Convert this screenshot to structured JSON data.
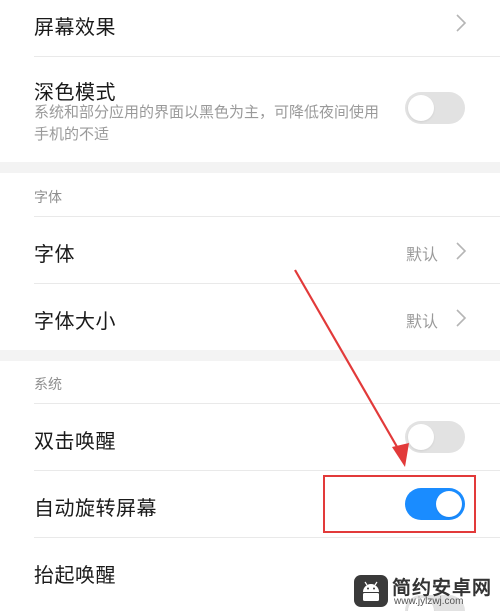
{
  "settings": {
    "screen_effect": {
      "title": "屏幕效果"
    },
    "dark_mode": {
      "title": "深色模式",
      "description": "系统和部分应用的界面以黑色为主，可降低夜间使用手机的不适",
      "enabled": false
    },
    "font_section": {
      "header": "字体",
      "font": {
        "title": "字体",
        "value": "默认"
      },
      "font_size": {
        "title": "字体大小",
        "value": "默认"
      }
    },
    "system_section": {
      "header": "系统",
      "double_tap_wake": {
        "title": "双击唤醒",
        "enabled": false
      },
      "auto_rotate": {
        "title": "自动旋转屏幕",
        "enabled": true
      },
      "lift_to_wake": {
        "title": "抬起唤醒",
        "enabled": false
      }
    }
  },
  "colors": {
    "toggle_on": "#1a8cff",
    "toggle_off": "#e2e2e2",
    "annotation": "#e23a3a"
  },
  "watermark": {
    "title": "简约安卓网",
    "url": "www.jylzwj.com",
    "icon": "android-robot-icon"
  }
}
